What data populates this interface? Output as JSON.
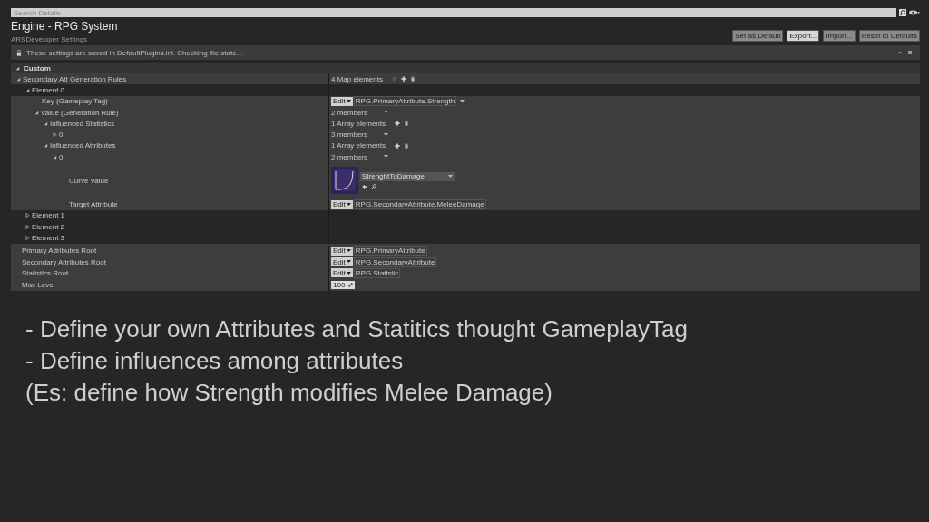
{
  "search": {
    "placeholder": "Search Details"
  },
  "title": "Engine - RPG System",
  "subtitle": "ARSDeveloper Settings",
  "header_buttons": [
    {
      "label": "Set as Default",
      "highlighted": false
    },
    {
      "label": "Export...",
      "highlighted": true
    },
    {
      "label": "Import...",
      "highlighted": false
    },
    {
      "label": "Reset to Defaults",
      "highlighted": false
    }
  ],
  "notice": "These settings are saved in DefaultPlugins.ini. Checking file state...",
  "custom": {
    "label": "Custom",
    "expanded": true,
    "rows": [
      {
        "label": "Secondary Att Generation Rules",
        "expanded": true,
        "value": {
          "kind": "map",
          "text": "4 Map elements"
        },
        "children": [
          {
            "label": "Element 0",
            "expanded": true,
            "children": [
              {
                "label": "Key (Gameplay Tag)",
                "value": {
                  "kind": "tag",
                  "button": "Edit",
                  "text": "RPG.PrimaryAttribute.Strength",
                  "dropdown": true
                }
              },
              {
                "label": "Value (Generation Rule)",
                "expanded": true,
                "value": {
                  "kind": "members",
                  "text": "2 members"
                },
                "children": [
                  {
                    "label": "Influenced Statistics",
                    "expanded": true,
                    "value": {
                      "kind": "array",
                      "text": "1 Array elements"
                    },
                    "children": [
                      {
                        "label": "0",
                        "expanded": false,
                        "value": {
                          "kind": "members",
                          "text": "3 members"
                        }
                      }
                    ]
                  },
                  {
                    "label": "Influenced Attributes",
                    "expanded": true,
                    "value": {
                      "kind": "array",
                      "text": "1 Array elements"
                    },
                    "children": [
                      {
                        "label": "0",
                        "expanded": true,
                        "value": {
                          "kind": "members",
                          "text": "2 members"
                        },
                        "children": [
                          {
                            "label": "Curve Value",
                            "value": {
                              "kind": "curve",
                              "text": "StrenghtToDamage"
                            }
                          },
                          {
                            "label": "Target Attribute",
                            "value": {
                              "kind": "tag",
                              "button": "Edit",
                              "text": "RPG.SecondaryAttribute.MeleeDamage",
                              "dropdown": false
                            }
                          }
                        ]
                      }
                    ]
                  }
                ]
              }
            ]
          },
          {
            "label": "Element 1",
            "expanded": false
          },
          {
            "label": "Element 2",
            "expanded": false
          },
          {
            "label": "Element 3",
            "expanded": false
          }
        ]
      }
    ]
  },
  "settings": [
    {
      "label": "Primary Attributes Root",
      "value": {
        "kind": "tag",
        "button": "Edit",
        "text": "RPG.PrimaryAttribute",
        "dropdown": false
      }
    },
    {
      "label": "Secondary Attributes Root",
      "value": {
        "kind": "tag",
        "button": "Edit",
        "text": "RPG.SecondaryAttribute",
        "dropdown": false
      }
    },
    {
      "label": "Statistics Root",
      "value": {
        "kind": "tag",
        "button": "Edit",
        "text": "RPG.Statistic",
        "dropdown": false
      }
    },
    {
      "label": "Max Level",
      "value": {
        "kind": "number",
        "text": "100"
      }
    }
  ],
  "caption": [
    "- Define your own Attributes and Statitics thought GameplayTag",
    "- Define influences among attributes",
    "(Es: define how Strength modifies Melee Damage)"
  ]
}
